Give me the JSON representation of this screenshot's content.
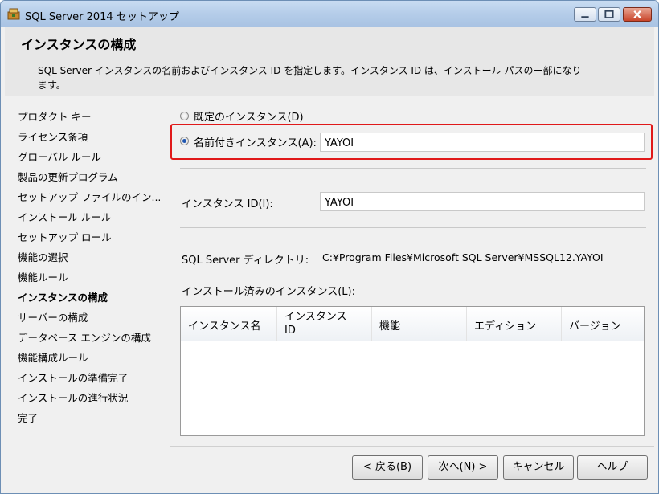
{
  "window": {
    "title": "SQL Server 2014 セットアップ"
  },
  "header": {
    "title": "インスタンスの構成",
    "description": "SQL Server インスタンスの名前およびインスタンス ID を指定します。インスタンス ID は、インストール パスの一部になります。"
  },
  "sidebar": {
    "steps": [
      "プロダクト キー",
      "ライセンス条項",
      "グローバル ルール",
      "製品の更新プログラム",
      "セットアップ ファイルのイン...",
      "インストール ルール",
      "セットアップ ロール",
      "機能の選択",
      "機能ルール",
      "インスタンスの構成",
      "サーバーの構成",
      "データベース エンジンの構成",
      "機能構成ルール",
      "インストールの準備完了",
      "インストールの進行状況",
      "完了"
    ],
    "active_index": 9
  },
  "form": {
    "default_instance_label": "既定のインスタンス(D)",
    "named_instance_label": "名前付きインスタンス(A):",
    "named_instance_value": "YAYOI",
    "named_instance_selected": true,
    "instance_id_label": "インスタンス ID(I):",
    "instance_id_value": "YAYOI",
    "directory_label": "SQL Server ディレクトリ:",
    "directory_value": "C:¥Program Files¥Microsoft SQL Server¥MSSQL12.YAYOI",
    "installed_label": "インストール済みのインスタンス(L):",
    "installed_columns": [
      "インスタンス名",
      "インスタンス ID",
      "機能",
      "エディション",
      "バージョン"
    ],
    "installed_rows": []
  },
  "buttons": {
    "back": "< 戻る(B)",
    "next": "次へ(N) >",
    "cancel": "キャンセル",
    "help": "ヘルプ"
  },
  "colors": {
    "highlight": "#e0191a",
    "title_bar": "#b5cde9"
  }
}
